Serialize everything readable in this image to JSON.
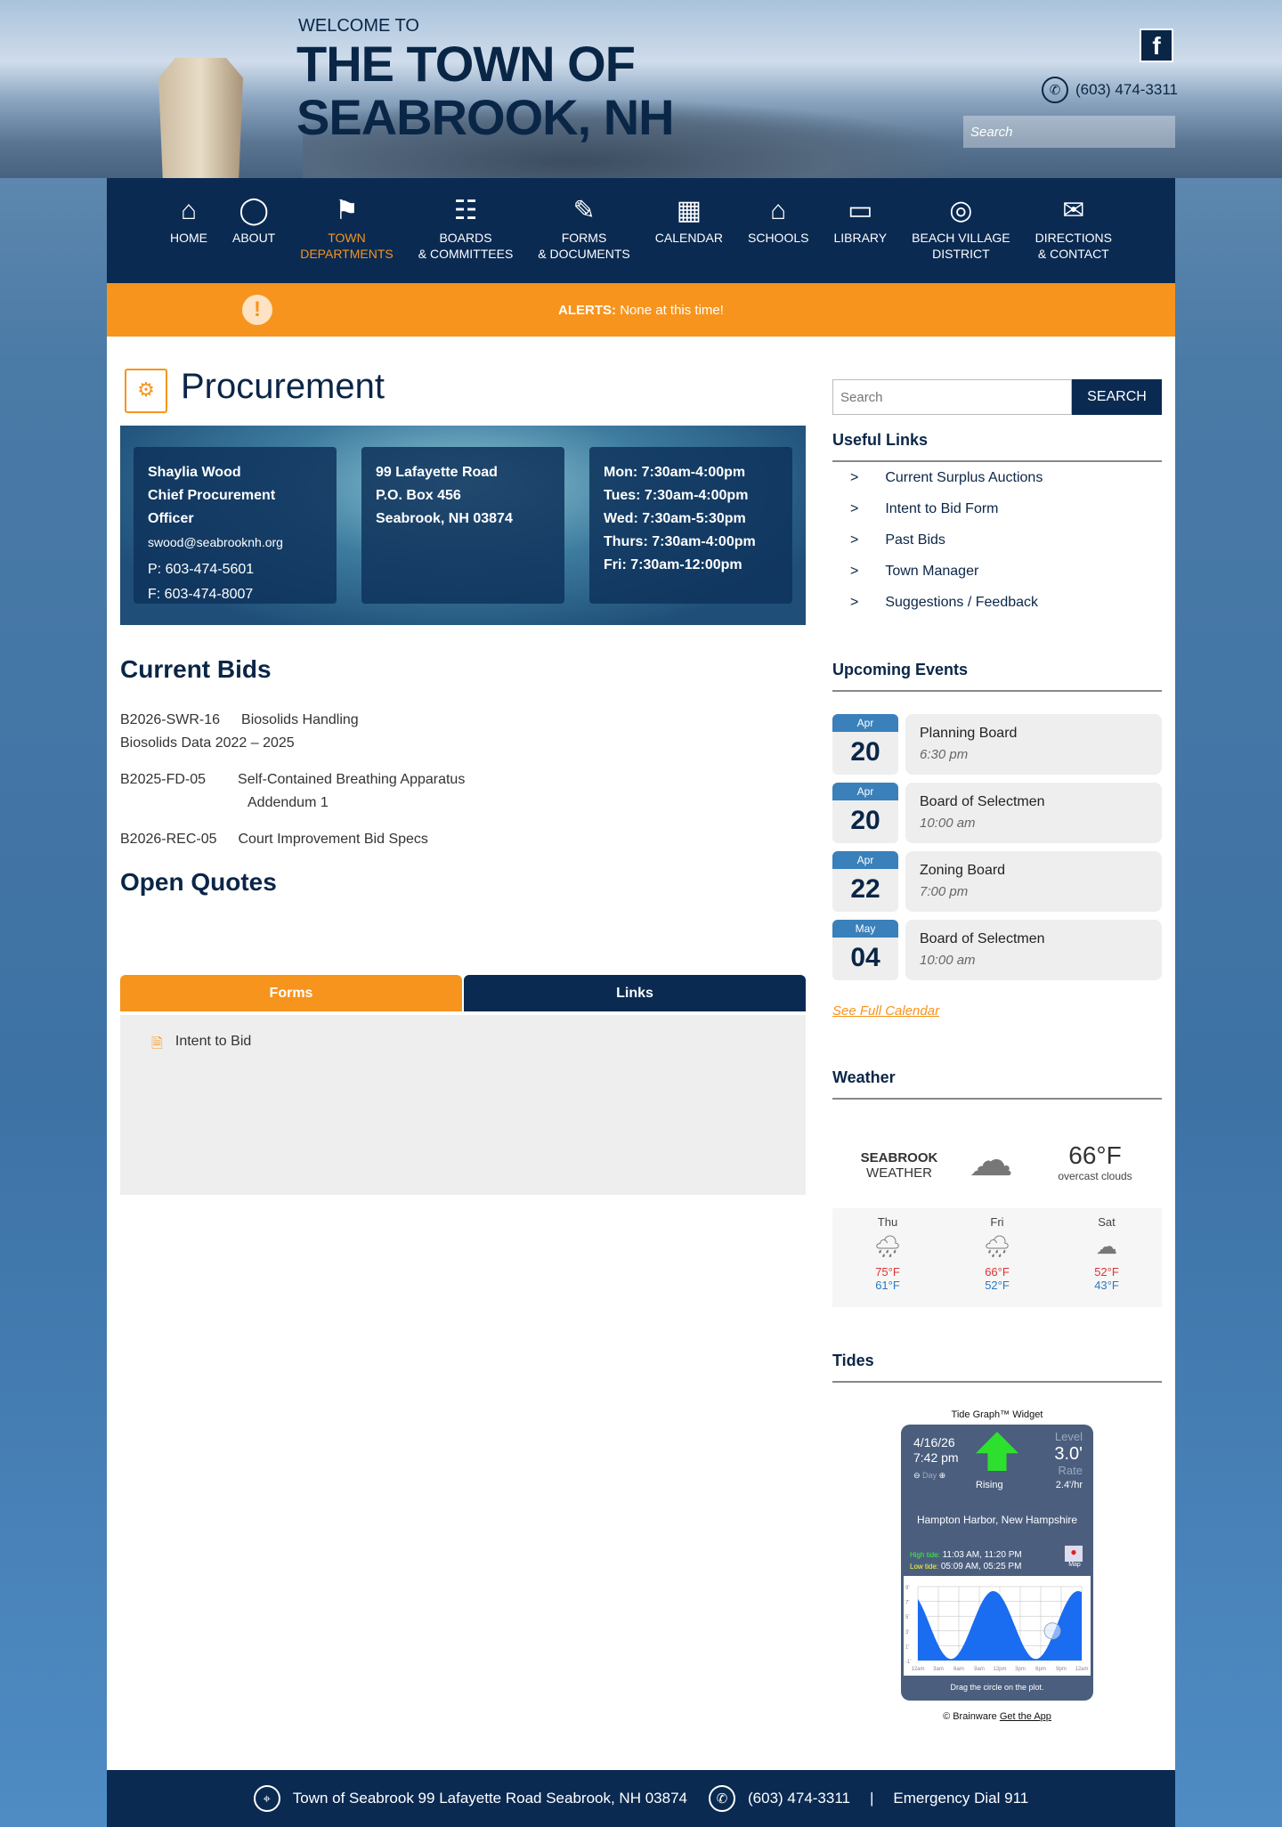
{
  "header": {
    "welcome": "WELCOME TO",
    "title_line1": "THE TOWN OF",
    "title_line2": "SEABROOK, NH",
    "facebook": "f",
    "phone": "(603) 474-3311",
    "search_placeholder": "Search"
  },
  "nav": [
    {
      "label1": "HOME",
      "label2": "",
      "icon": "⌂"
    },
    {
      "label1": "ABOUT",
      "label2": "",
      "icon": "◯"
    },
    {
      "label1": "TOWN",
      "label2": "DEPARTMENTS",
      "icon": "⚑",
      "active": true
    },
    {
      "label1": "BOARDS",
      "label2": "& COMMITTEES",
      "icon": "☷"
    },
    {
      "label1": "FORMS",
      "label2": "& DOCUMENTS",
      "icon": "✎"
    },
    {
      "label1": "CALENDAR",
      "label2": "",
      "icon": "▦"
    },
    {
      "label1": "SCHOOLS",
      "label2": "",
      "icon": "⌂"
    },
    {
      "label1": "LIBRARY",
      "label2": "",
      "icon": "▭"
    },
    {
      "label1": "BEACH VILLAGE",
      "label2": "DISTRICT",
      "icon": "◎"
    },
    {
      "label1": "DIRECTIONS",
      "label2": "& CONTACT",
      "icon": "✉"
    }
  ],
  "alert": {
    "label": "ALERTS:",
    "text": " None at this time!",
    "icon": "!"
  },
  "page": {
    "title": "Procurement"
  },
  "contact": {
    "name": "Shaylia Wood",
    "role": "Chief Procurement Officer",
    "email": "swood@seabrooknh.org",
    "phone": "P: 603-474-5601",
    "fax": "F: 603-474-8007",
    "addr1": "99 Lafayette Road",
    "addr2": "P.O. Box 456",
    "addr3": "Seabrook, NH 03874",
    "hours": [
      "Mon: 7:30am-4:00pm",
      "Tues: 7:30am-4:00pm",
      "Wed: 7:30am-5:30pm",
      "Thurs: 7:30am-4:00pm",
      "Fri: 7:30am-12:00pm"
    ]
  },
  "bids": {
    "heading": "Current Bids",
    "items": [
      {
        "id": "B2026-SWR-16",
        "title": "Biosolids Handling",
        "sub": "Biosolids Data 2022 – 2025"
      },
      {
        "id": "B2025-FD-05",
        "title": "Self-Contained Breathing Apparatus",
        "sub": "Addendum 1"
      },
      {
        "id": "B2026-REC-05",
        "title": "Court Improvement Bid Specs"
      }
    ]
  },
  "quotes": {
    "heading": "Open Quotes"
  },
  "tabs": {
    "forms": "Forms",
    "links": "Links",
    "items": [
      "Intent to Bid"
    ]
  },
  "sidebar": {
    "search_placeholder": "Search",
    "search_button": "SEARCH",
    "useful_heading": "Useful Links",
    "links": [
      "Current Surplus Auctions",
      "Intent to Bid Form",
      "Past Bids",
      "Town Manager",
      "Suggestions / Feedback"
    ],
    "events_heading": "Upcoming Events",
    "events": [
      {
        "month": "Apr",
        "day": "20",
        "title": "Planning Board",
        "time": "6:30 pm"
      },
      {
        "month": "Apr",
        "day": "20",
        "title": "Board of Selectmen",
        "time": "10:00 am"
      },
      {
        "month": "Apr",
        "day": "22",
        "title": "Zoning Board",
        "time": "7:00 pm"
      },
      {
        "month": "May",
        "day": "04",
        "title": "Board of Selectmen",
        "time": "10:00 am"
      }
    ],
    "full_calendar": "See Full Calendar"
  },
  "weather": {
    "heading": "Weather",
    "label1": "SEABROOK",
    "label2": "WEATHER",
    "temp": "66°F",
    "desc": "overcast clouds",
    "forecast": [
      {
        "day": "Thu",
        "hi": "75°F",
        "lo": "61°F"
      },
      {
        "day": "Fri",
        "hi": "66°F",
        "lo": "52°F"
      },
      {
        "day": "Sat",
        "hi": "52°F",
        "lo": "43°F"
      }
    ]
  },
  "tides": {
    "heading": "Tides",
    "widget_title": "Tide Graph™ Widget",
    "date": "4/16/26",
    "time": "7:42 pm",
    "day": "Day",
    "trend": "Rising",
    "level_label": "Level",
    "level": "3.0'",
    "rate_label": "Rate",
    "rate": "2.4'/hr",
    "location": "Hampton Harbor, New Hampshire",
    "high_label": "High tide:",
    "high": "11:03 AM, 11:20 PM",
    "low_label": "Low tide:",
    "low": "05:09 AM, 05:25 PM",
    "map": "Map",
    "y_ticks": [
      "9'",
      "7'",
      "5'",
      "3'",
      "1'",
      "-1'"
    ],
    "x_ticks": [
      "12am",
      "3am",
      "6am",
      "9am",
      "12pm",
      "3pm",
      "6pm",
      "9pm",
      "12am"
    ],
    "hint": "Drag the circle on the plot.",
    "credit": "© Brainware",
    "app": "Get the App"
  },
  "footer": {
    "address": "Town of Seabrook 99 Lafayette Road Seabrook, NH 03874",
    "phone": "(603) 474-3311",
    "sep": "|",
    "emergency": "Emergency Dial 911"
  }
}
